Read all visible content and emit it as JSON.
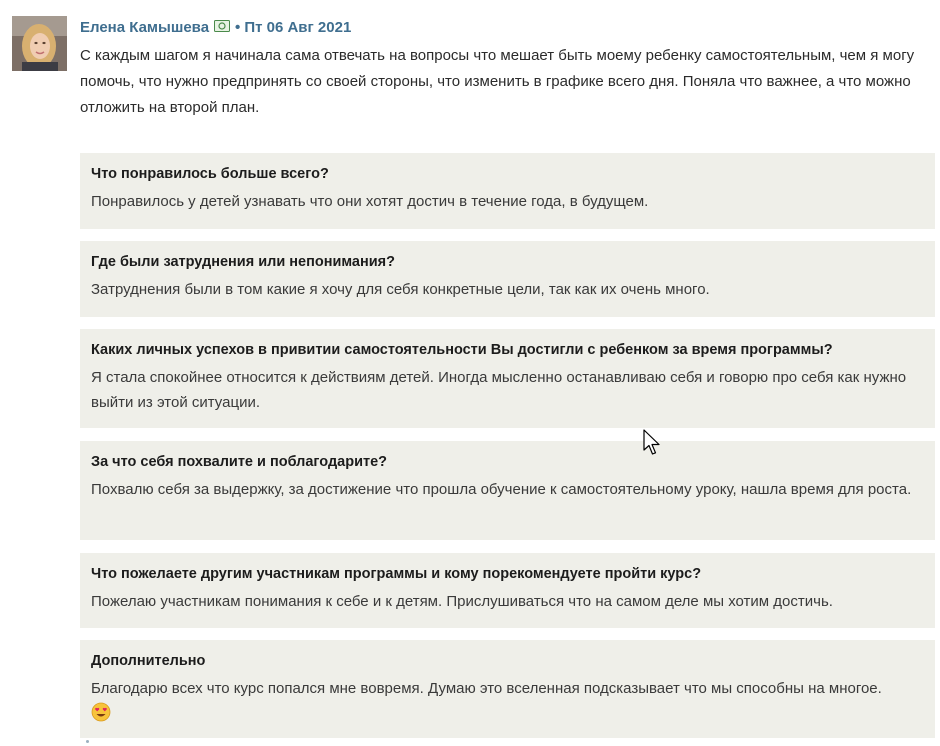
{
  "comment": {
    "author": "Елена Камышева",
    "date": "Пт 06 Авг 2021",
    "separator": "•",
    "intro": "С каждым шагом я начинала сама отвечать на вопросы что мешает быть моему ребенку самостоятельным, чем я могу помочь, что нужно предпринять со своей стороны, что изменить в графике всего дня. Поняла что важнее, а что можно отложить на второй план.",
    "qa": [
      {
        "question": "Что понравилось больше всего?",
        "answer": "Понравилось у детей узнавать что они хотят достич в течение года, в будущем."
      },
      {
        "question": "Где были затруднения или непонимания?",
        "answer": "Затруднения были в том какие я хочу для себя конкретные цели, так как их очень много."
      },
      {
        "question": "Каких личных успехов в привитии самостоятельности Вы достигли с ребенком за время программы?",
        "answer": "Я стала спокойнее относится к действиям детей. Иногда мысленно останавливаю себя и говорю про себя как нужно выйти из этой ситуации."
      },
      {
        "question": "За что себя похвалите и поблагодарите?",
        "answer": "Похвалю себя за выдержку, за достижение что прошла обучение к самостоятельному уроку, нашла время для роста."
      },
      {
        "question": "Что пожелаете другим участникам программы и кому порекомендуете пройти курс?",
        "answer": "Пожелаю участникам понимания к себе и к детям. Прислушиваться что на самом деле мы хотим достичь."
      },
      {
        "question": "Дополнительно",
        "answer": "Благодарю всех что курс попался мне вовремя. Думаю это вселенная подсказывает что мы способны на многое."
      }
    ]
  },
  "icons": {
    "badge": "money-icon",
    "emoji": "heart-eyes-emoji-icon",
    "cursor": "mouse-pointer-icon"
  },
  "colors": {
    "author": "#3f6e8f",
    "qa_background": "#efefe9"
  }
}
